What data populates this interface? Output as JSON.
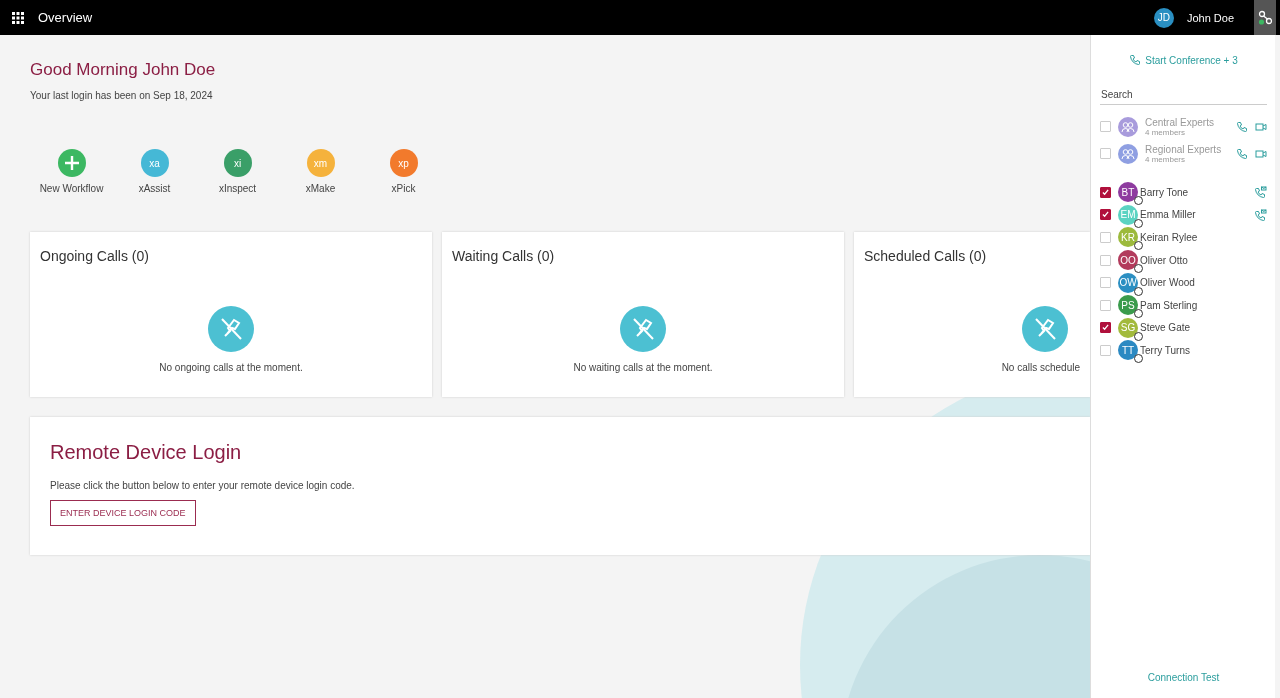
{
  "top_bar": {
    "title": "Overview",
    "user": {
      "initials": "JD",
      "name": "John Doe"
    }
  },
  "greeting": {
    "title": "Good Morning John Doe",
    "subtitle": "Your last login has been on Sep 18, 2024"
  },
  "apps": [
    {
      "kind": "add",
      "label": "New Workflow",
      "color": "#3cb862"
    },
    {
      "kind": "app",
      "badge": "xa",
      "label": "xAssist",
      "color": "#45b8d6"
    },
    {
      "kind": "app",
      "badge": "xi",
      "label": "xInspect",
      "color": "#3a9f68"
    },
    {
      "kind": "app",
      "badge": "xm",
      "label": "xMake",
      "color": "#f5b23c"
    },
    {
      "kind": "app",
      "badge": "xp",
      "label": "xPick",
      "color": "#f27a2c"
    }
  ],
  "call_cards": [
    {
      "title": "Ongoing Calls (0)",
      "message": "No ongoing calls at the moment."
    },
    {
      "title": "Waiting Calls (0)",
      "message": "No waiting calls at the moment."
    },
    {
      "title": "Scheduled Calls (0)",
      "message": "No calls schedule"
    }
  ],
  "remote_login": {
    "title": "Remote Device Login",
    "text": "Please click the button below to enter your remote device login code.",
    "button": "ENTER DEVICE LOGIN CODE"
  },
  "sidebar": {
    "conference": "Start Conference + 3",
    "search": {
      "placeholder": "Search"
    },
    "groups": [
      {
        "name": "Central Experts",
        "members": "4 members",
        "checked": false,
        "color": "#a89bdc"
      },
      {
        "name": "Regional Experts",
        "members": "4 members",
        "checked": false,
        "color": "#8f9fe2"
      }
    ],
    "contacts": [
      {
        "initials": "BT",
        "name": "Barry Tone",
        "color": "#8e3b9f",
        "checked": true,
        "in_call": true
      },
      {
        "initials": "EM",
        "name": "Emma Miller",
        "color": "#5bd3c2",
        "checked": true,
        "in_call": true
      },
      {
        "initials": "KR",
        "name": "Keiran Rylee",
        "color": "#9cba3c",
        "checked": false,
        "in_call": false
      },
      {
        "initials": "OO",
        "name": "Oliver Otto",
        "color": "#b23b5c",
        "checked": false,
        "in_call": false
      },
      {
        "initials": "OW",
        "name": "Oliver Wood",
        "color": "#2b8fc2",
        "checked": false,
        "in_call": false
      },
      {
        "initials": "PS",
        "name": "Pam Sterling",
        "color": "#3a9b4c",
        "checked": false,
        "in_call": false
      },
      {
        "initials": "SG",
        "name": "Steve Gate",
        "color": "#a2ba3c",
        "checked": true,
        "in_call": false
      },
      {
        "initials": "TT",
        "name": "Terry Turns",
        "color": "#2b89c2",
        "checked": false,
        "in_call": false
      }
    ],
    "footer": "Connection Test"
  }
}
